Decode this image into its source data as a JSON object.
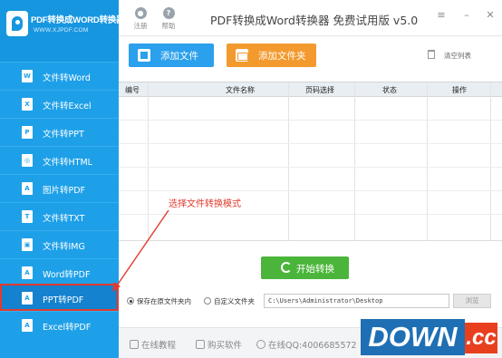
{
  "app": {
    "logo_title": "PDF转换成WORD转换器",
    "logo_url": "WWW.XJPDF.COM",
    "window_title": "PDF转换成Word转换器 免费试用版 v5.0"
  },
  "topbar": {
    "register_label": "注册",
    "help_label": "帮助"
  },
  "sidebar": {
    "items": [
      {
        "label": "文件转Word",
        "icon": "word-icon",
        "glyph": "W"
      },
      {
        "label": "文件转Excel",
        "icon": "excel-icon",
        "glyph": "X"
      },
      {
        "label": "文件转PPT",
        "icon": "ppt-icon",
        "glyph": "P"
      },
      {
        "label": "文件转HTML",
        "icon": "globe-icon",
        "glyph": "◎"
      },
      {
        "label": "图片转PDF",
        "icon": "pdf-icon",
        "glyph": "A"
      },
      {
        "label": "文件转TXT",
        "icon": "txt-icon",
        "glyph": "T"
      },
      {
        "label": "文件转IMG",
        "icon": "image-icon",
        "glyph": "▣"
      },
      {
        "label": "Word转PDF",
        "icon": "pdf-icon",
        "glyph": "A"
      },
      {
        "label": "PPT转PDF",
        "icon": "pdf-icon",
        "glyph": "A",
        "active": true
      },
      {
        "label": "Excel转PDF",
        "icon": "pdf-icon",
        "glyph": "A"
      }
    ]
  },
  "toolbar": {
    "add_file_label": "添加文件",
    "add_folder_label": "添加文件夹",
    "clear_list_label": "清空列表"
  },
  "table": {
    "columns": [
      "编号",
      "文件名称",
      "页码选择",
      "状态",
      "操作"
    ],
    "rows": []
  },
  "annotation": {
    "text": "选择文件转换模式"
  },
  "start_label": "开始转换",
  "output": {
    "option_original": "保存在原文件夹内",
    "option_custom": "自定义文件夹",
    "selected": "option_original",
    "path": "C:\\Users\\Administrator\\Desktop",
    "browse_label": "浏览"
  },
  "footer": {
    "tutorial_label": "在线教程",
    "buy_label": "购买软件",
    "qq_label": "在线QQ:4006685572"
  },
  "watermark": {
    "part1": "DOWN",
    "part2": ".cc"
  },
  "colors": {
    "sidebar": "#1ea0e8",
    "sidebar_active": "#1482cf",
    "add_file": "#2ba0ec",
    "add_folder": "#f39a2e",
    "start": "#4bb53b",
    "annotation": "#e23b2e"
  }
}
